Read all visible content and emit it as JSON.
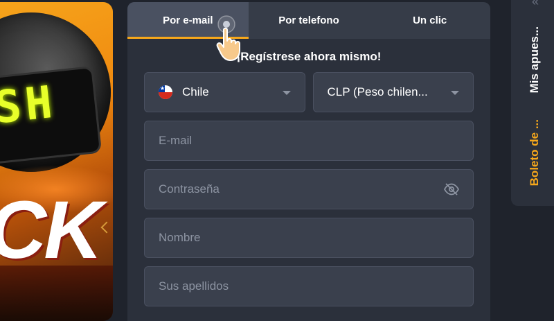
{
  "tabs": [
    {
      "label": "Por e-mail",
      "active": true
    },
    {
      "label": "Por telefono",
      "active": false
    },
    {
      "label": "Un clic",
      "active": false
    }
  ],
  "heading": "¡Regístrese ahora mismo!",
  "country": {
    "value": "Chile",
    "flag_icon": "chile-flag-icon"
  },
  "currency": {
    "value": "CLP (Peso chilen..."
  },
  "fields": {
    "email_placeholder": "E-mail",
    "password_placeholder": "Contraseña",
    "name_placeholder": "Nombre",
    "surname_placeholder": "Sus apellidos"
  },
  "side_panel": {
    "my_bets": "Mis apues...",
    "bet_slip": "Boleto de ..."
  },
  "colors": {
    "accent": "#f7a81b",
    "panel_bg": "#2b303b",
    "field_bg": "#3a404d"
  }
}
